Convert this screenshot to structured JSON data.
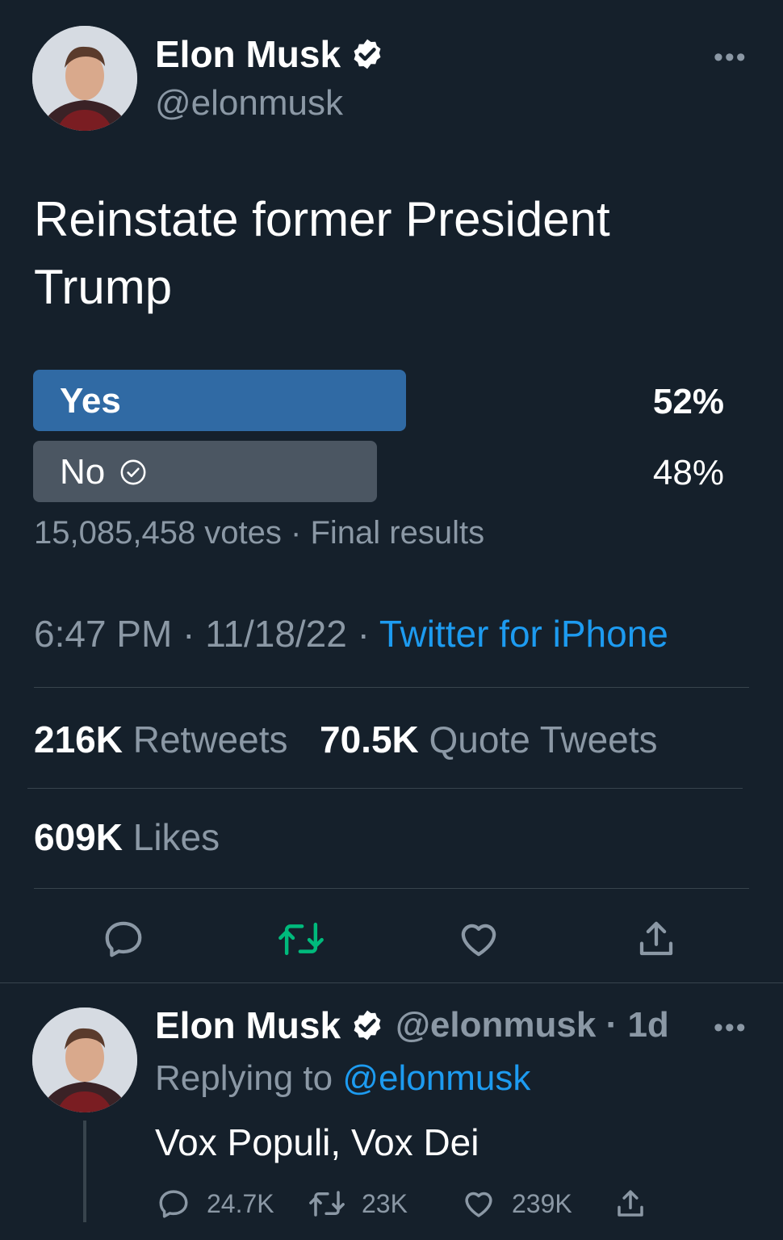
{
  "tweet": {
    "author_name": "Elon Musk",
    "author_handle": "@elonmusk",
    "more_label": "•••",
    "text": "Reinstate former President Trump",
    "poll": {
      "options": [
        {
          "label": "Yes",
          "percent_label": "52%",
          "percent": 52,
          "leading": true,
          "voted": false
        },
        {
          "label": "No",
          "percent_label": "48%",
          "percent": 48,
          "leading": false,
          "voted": true
        }
      ],
      "votes_text": "15,085,458 votes",
      "separator": " · ",
      "status_text": "Final results"
    },
    "time": "6:47 PM",
    "date": "11/18/22",
    "source": "Twitter for iPhone",
    "stats": {
      "retweets_count": "216K",
      "retweets_label": "Retweets",
      "quotes_count": "70.5K",
      "quotes_label": "Quote Tweets",
      "likes_count": "609K",
      "likes_label": "Likes"
    }
  },
  "reply": {
    "author_name": "Elon Musk",
    "author_handle": "@elonmusk",
    "age": "1d",
    "replying_prefix": "Replying to",
    "replying_to": "@elonmusk",
    "text": "Vox Populi, Vox Dei",
    "replies": "24.7K",
    "retweets": "23K",
    "likes": "239K"
  },
  "colors": {
    "background": "#15202b",
    "poll_leading": "#306aa4",
    "poll_other": "#4b5662",
    "link": "#1d9bf0",
    "muted": "#8b98a5",
    "retweet_green": "#00ba7c"
  },
  "icons": [
    "verified-badge-icon",
    "more-icon",
    "check-circle-icon",
    "reply-icon",
    "retweet-icon",
    "like-icon",
    "share-icon"
  ]
}
